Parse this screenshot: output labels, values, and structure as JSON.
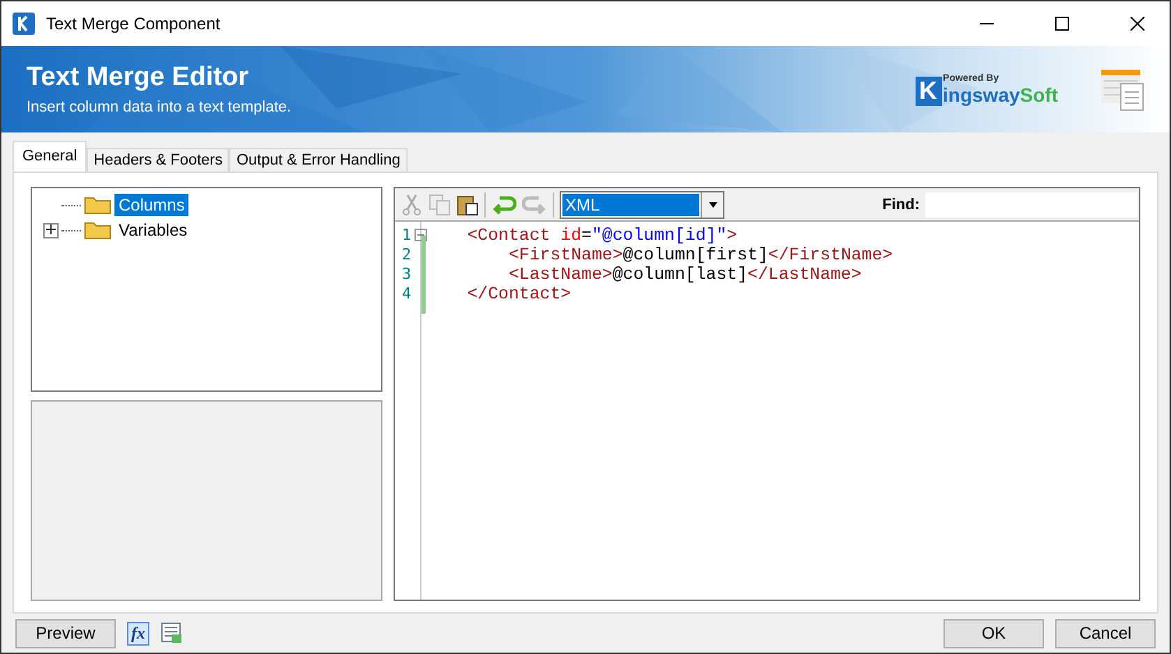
{
  "window": {
    "title": "Text Merge Component"
  },
  "banner": {
    "title": "Text Merge Editor",
    "subtitle": "Insert column data into a text template.",
    "logo_small": "Powered By",
    "logo_initial": "K",
    "logo_rest": "ingsway",
    "logo_end": "Soft"
  },
  "tabs": [
    {
      "label": "General",
      "selected": true
    },
    {
      "label": "Headers & Footers",
      "selected": false
    },
    {
      "label": "Output & Error Handling",
      "selected": false
    }
  ],
  "tree": [
    {
      "label": "Columns",
      "selected": true,
      "expandable": false
    },
    {
      "label": "Variables",
      "selected": false,
      "expandable": true
    }
  ],
  "editor": {
    "language": "XML",
    "find_label": "Find:",
    "lines": [
      {
        "number": "1",
        "foldable": true,
        "tokens": [
          {
            "kind": "tag",
            "text": "    <Contact "
          },
          {
            "kind": "attr",
            "text": "id"
          },
          {
            "kind": "text",
            "text": "="
          },
          {
            "kind": "string",
            "text": "\"@column[id]\""
          },
          {
            "kind": "tag",
            "text": ">"
          }
        ]
      },
      {
        "number": "2",
        "foldable": false,
        "tokens": [
          {
            "kind": "tag",
            "text": "        <FirstName>"
          },
          {
            "kind": "text",
            "text": "@column[first]"
          },
          {
            "kind": "tag",
            "text": "</FirstName>"
          }
        ]
      },
      {
        "number": "3",
        "foldable": false,
        "tokens": [
          {
            "kind": "tag",
            "text": "        <LastName>"
          },
          {
            "kind": "text",
            "text": "@column[last]"
          },
          {
            "kind": "tag",
            "text": "</LastName>"
          }
        ]
      },
      {
        "number": "4",
        "foldable": false,
        "tokens": [
          {
            "kind": "tag",
            "text": "    </Contact>"
          }
        ]
      }
    ]
  },
  "footer": {
    "preview": "Preview",
    "fx": "fx",
    "ok": "OK",
    "cancel": "Cancel"
  }
}
